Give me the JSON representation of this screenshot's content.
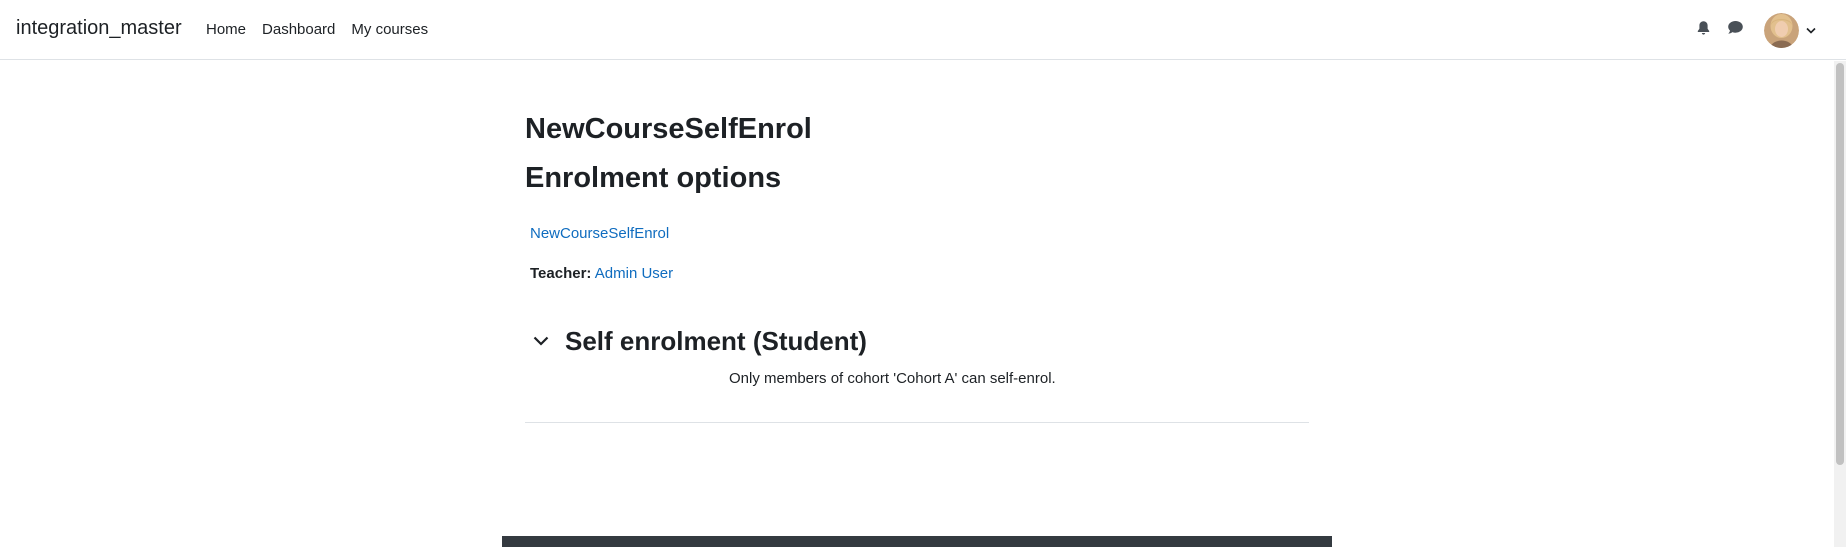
{
  "site": {
    "name": "integration_master"
  },
  "nav": {
    "items": [
      {
        "label": "Home"
      },
      {
        "label": "Dashboard"
      },
      {
        "label": "My courses"
      }
    ]
  },
  "header_icons": {
    "notifications": "bell-icon",
    "messages": "chat-bubble-icon",
    "user_menu_caret": "chevron-down-icon"
  },
  "page": {
    "title": "NewCourseSelfEnrol",
    "subtitle": "Enrolment options",
    "course_link": "NewCourseSelfEnrol",
    "teacher_label": "Teacher:",
    "teacher_name": "Admin User"
  },
  "enrolment_section": {
    "heading": "Self enrolment (Student)",
    "message": "Only members of cohort 'Cohort A' can self-enrol."
  },
  "colors": {
    "link": "#0f6cbf",
    "text": "#1d2125",
    "footer": "#343a40",
    "border": "#dee2e6"
  }
}
